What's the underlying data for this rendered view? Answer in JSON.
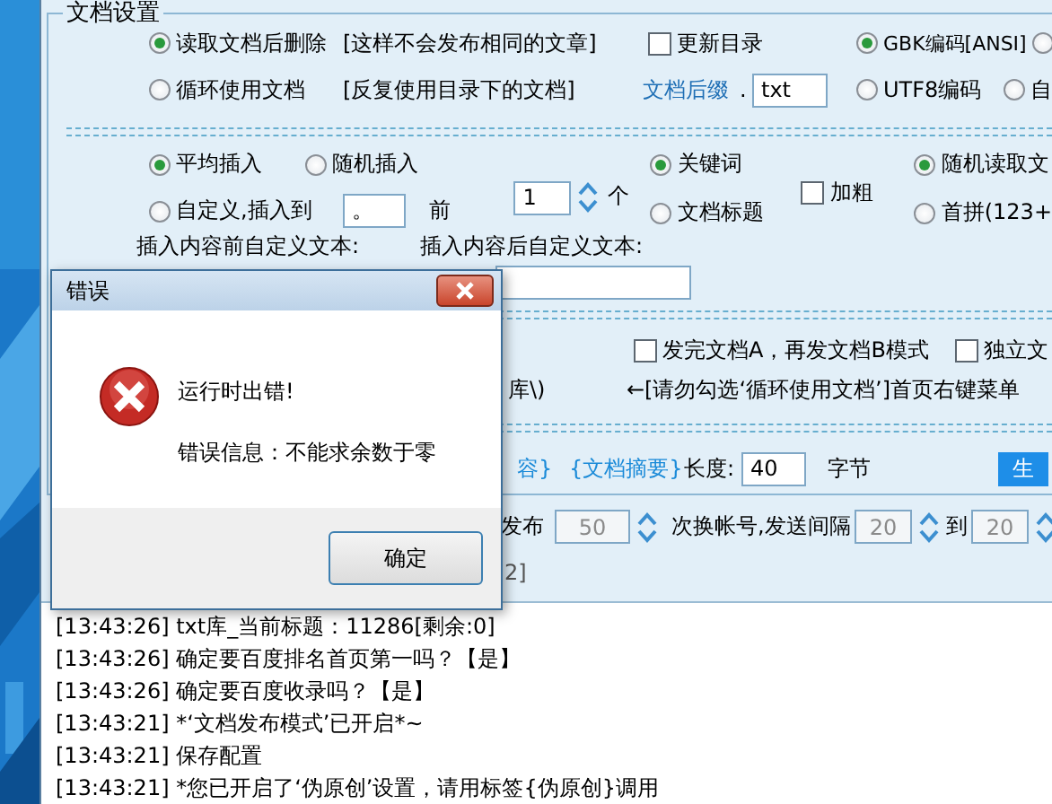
{
  "group_title": "文档设置",
  "delete_mode": [
    {
      "label": "读取文档后删除",
      "note": "[这样不会发布相同的文章]",
      "selected": true
    },
    {
      "label": "循环使用文档",
      "note": "[反复使用目录下的文档]",
      "selected": false
    }
  ],
  "update_catalog": {
    "label": "更新目录",
    "checked": false
  },
  "suffix": {
    "label": "文档后缀",
    "dot": ".",
    "value": "txt"
  },
  "encoding": [
    {
      "label": "GBK编码[ANSI]",
      "selected": true
    },
    {
      "label": "UTF8编码",
      "selected": false
    }
  ],
  "other_encoding": [
    {
      "selected": false
    },
    {
      "label": "自",
      "selected": false
    }
  ],
  "insert_mode": [
    {
      "label": "平均插入",
      "selected": true
    },
    {
      "label": "随机插入",
      "selected": false
    },
    {
      "label": "自定义,插入到",
      "selected": false
    }
  ],
  "insert_position": {
    "value": "。",
    "suffix": "前"
  },
  "count": {
    "value": "1",
    "unit": "个"
  },
  "insert_target": [
    {
      "label": "关键词",
      "selected": true
    },
    {
      "label": "文档标题",
      "selected": false
    }
  ],
  "bold": {
    "label": "加粗",
    "checked": false
  },
  "read_mode": [
    {
      "label": "随机读取文",
      "selected": true
    },
    {
      "label": "首拼(123+",
      "selected": false
    }
  ],
  "before_text_label": "插入内容前自定义文本:",
  "after_text_label": "插入内容后自定义文本:",
  "ab_mode": {
    "label": "发完文档A，再发文档B模式",
    "checked": false
  },
  "independent": {
    "label": "独立文",
    "checked": false
  },
  "partial_text": "库\\)",
  "hint": "←[请勿勾选‘循环使用文档’]首页右键菜单",
  "content_tag": "容}",
  "summary_tag": "{文档摘要}",
  "length": {
    "label": "长度:",
    "value": "40",
    "unit": "字节"
  },
  "generate_button": "生",
  "publish": {
    "label": "发布",
    "value": "50",
    "disabled": true,
    "switch_label": "次换帐号,发送间隔",
    "interval_from": "20",
    "to_label": "到",
    "interval_to": "20"
  },
  "partial_bracket": "2]",
  "log": [
    "[13:43:26] txt库_当前标题：11286[剩余:0]",
    "[13:43:26] 确定要百度排名首页第一吗？【是】",
    "[13:43:26] 确定要百度收录吗？【是】",
    "[13:43:21] *‘文档发布模式’已开启*~",
    "[13:43:21] 保存配置",
    "[13:43:21] *您已开启了‘伪原创’设置，请用标签{伪原创}调用"
  ],
  "dialog": {
    "title": "错误",
    "message": "运行时出错!",
    "detail": "错误信息：不能求余数于零",
    "button": "确定"
  }
}
